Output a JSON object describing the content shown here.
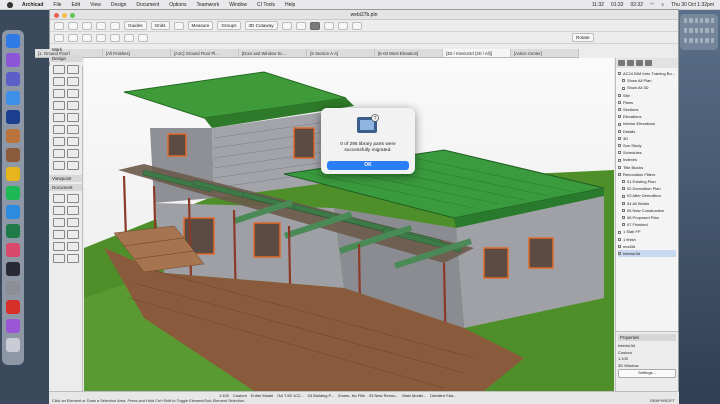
{
  "menubar": {
    "app_name": "Archicad",
    "items": [
      "File",
      "Edit",
      "View",
      "Design",
      "Document",
      "Options",
      "Teamwork",
      "Window",
      "CI Tools",
      "Help"
    ],
    "status_time_1": "11:32",
    "status_time_2": "01:32",
    "status_time_3": "02:32",
    "clock": "Thu 30 Oct 1:32pm"
  },
  "window": {
    "title": "webi27b.pln"
  },
  "toolbar": {
    "guides": "Guides",
    "grids": "Grids",
    "measure": "Measure",
    "groups": "Groups",
    "cutaway": "3D Cutaway",
    "rotate": "Rotate"
  },
  "tabs": [
    {
      "label": "[1. Ground Floor]"
    },
    {
      "label": "[All Finishes]"
    },
    {
      "label": "[A1C] Ground Floor Pl..."
    },
    {
      "label": "[Door and Window Sc..."
    },
    {
      "label": "[S Section A-A]"
    },
    {
      "label": "[E-04 West Elevation]"
    },
    {
      "label": "[3D / Interior3d (3D / All)]"
    },
    {
      "label": "[Action Center]"
    }
  ],
  "toolbox": {
    "design_header": "Design",
    "viewpoint_header": "Viewpoint",
    "document_header": "Document",
    "mark_label": "Mark"
  },
  "navigator": {
    "items": [
      {
        "label": "AC24 BIM Intro Training Bu...",
        "level": 0
      },
      {
        "label": "Show All Plan",
        "level": 1
      },
      {
        "label": "Show All 3D",
        "level": 1
      },
      {
        "label": "Site",
        "level": 0
      },
      {
        "label": "Plans",
        "level": 0
      },
      {
        "label": "Sections",
        "level": 0
      },
      {
        "label": "Elevations",
        "level": 0
      },
      {
        "label": "Interior Elevations",
        "level": 0
      },
      {
        "label": "Details",
        "level": 0
      },
      {
        "label": "3D",
        "level": 0
      },
      {
        "label": "Sun Study",
        "level": 0
      },
      {
        "label": "Schedules",
        "level": 0
      },
      {
        "label": "Indexes",
        "level": 0
      },
      {
        "label": "Title Blocks",
        "level": 0
      },
      {
        "label": "Renovation Filters",
        "level": 0
      },
      {
        "label": "01 Existing Plan",
        "level": 1
      },
      {
        "label": "02 Demolition Plan",
        "level": 1
      },
      {
        "label": "03 After Demolition",
        "level": 1
      },
      {
        "label": "04 All Works",
        "level": 1
      },
      {
        "label": "05 New Construction",
        "level": 1
      },
      {
        "label": "06 Proposed Plan",
        "level": 1
      },
      {
        "label": "07 Finished",
        "level": 1
      },
      {
        "label": "1 Slab FP",
        "level": 0
      },
      {
        "label": "1 finish",
        "level": 0
      },
      {
        "label": "mod3d",
        "level": 0
      },
      {
        "label": "Interior3d",
        "level": 0
      }
    ],
    "properties_header": "Properties",
    "prop_rows": [
      "Interior3d",
      "Custom",
      "1:100",
      "3D Window"
    ],
    "settings_label": "Settings..."
  },
  "statusbar": {
    "scale": "1:100",
    "items": [
      "Custom",
      "Entire Model",
      "GA T-50 1C2...",
      "03 Building P...",
      "Zones- No Fills",
      "03 New Renov...",
      "Main Model...",
      "Detailed Sha..."
    ],
    "hint": "Click an Element or Draw a Selection Area. Press and Hold Ctrl+Shift to Toggle Element/Sub-Element Selection.",
    "brand": "GRAPHISOFT"
  },
  "dialog": {
    "message": "0 of 295 library parts were successfully migrated.",
    "ok_label": "OK"
  },
  "colors": {
    "ok_button": "#2a7ef3",
    "roof_green": "#3f9a3a",
    "grass": "#4f8f2a",
    "cladding": "#9a9aa0",
    "timber": "#7b4a2c"
  }
}
